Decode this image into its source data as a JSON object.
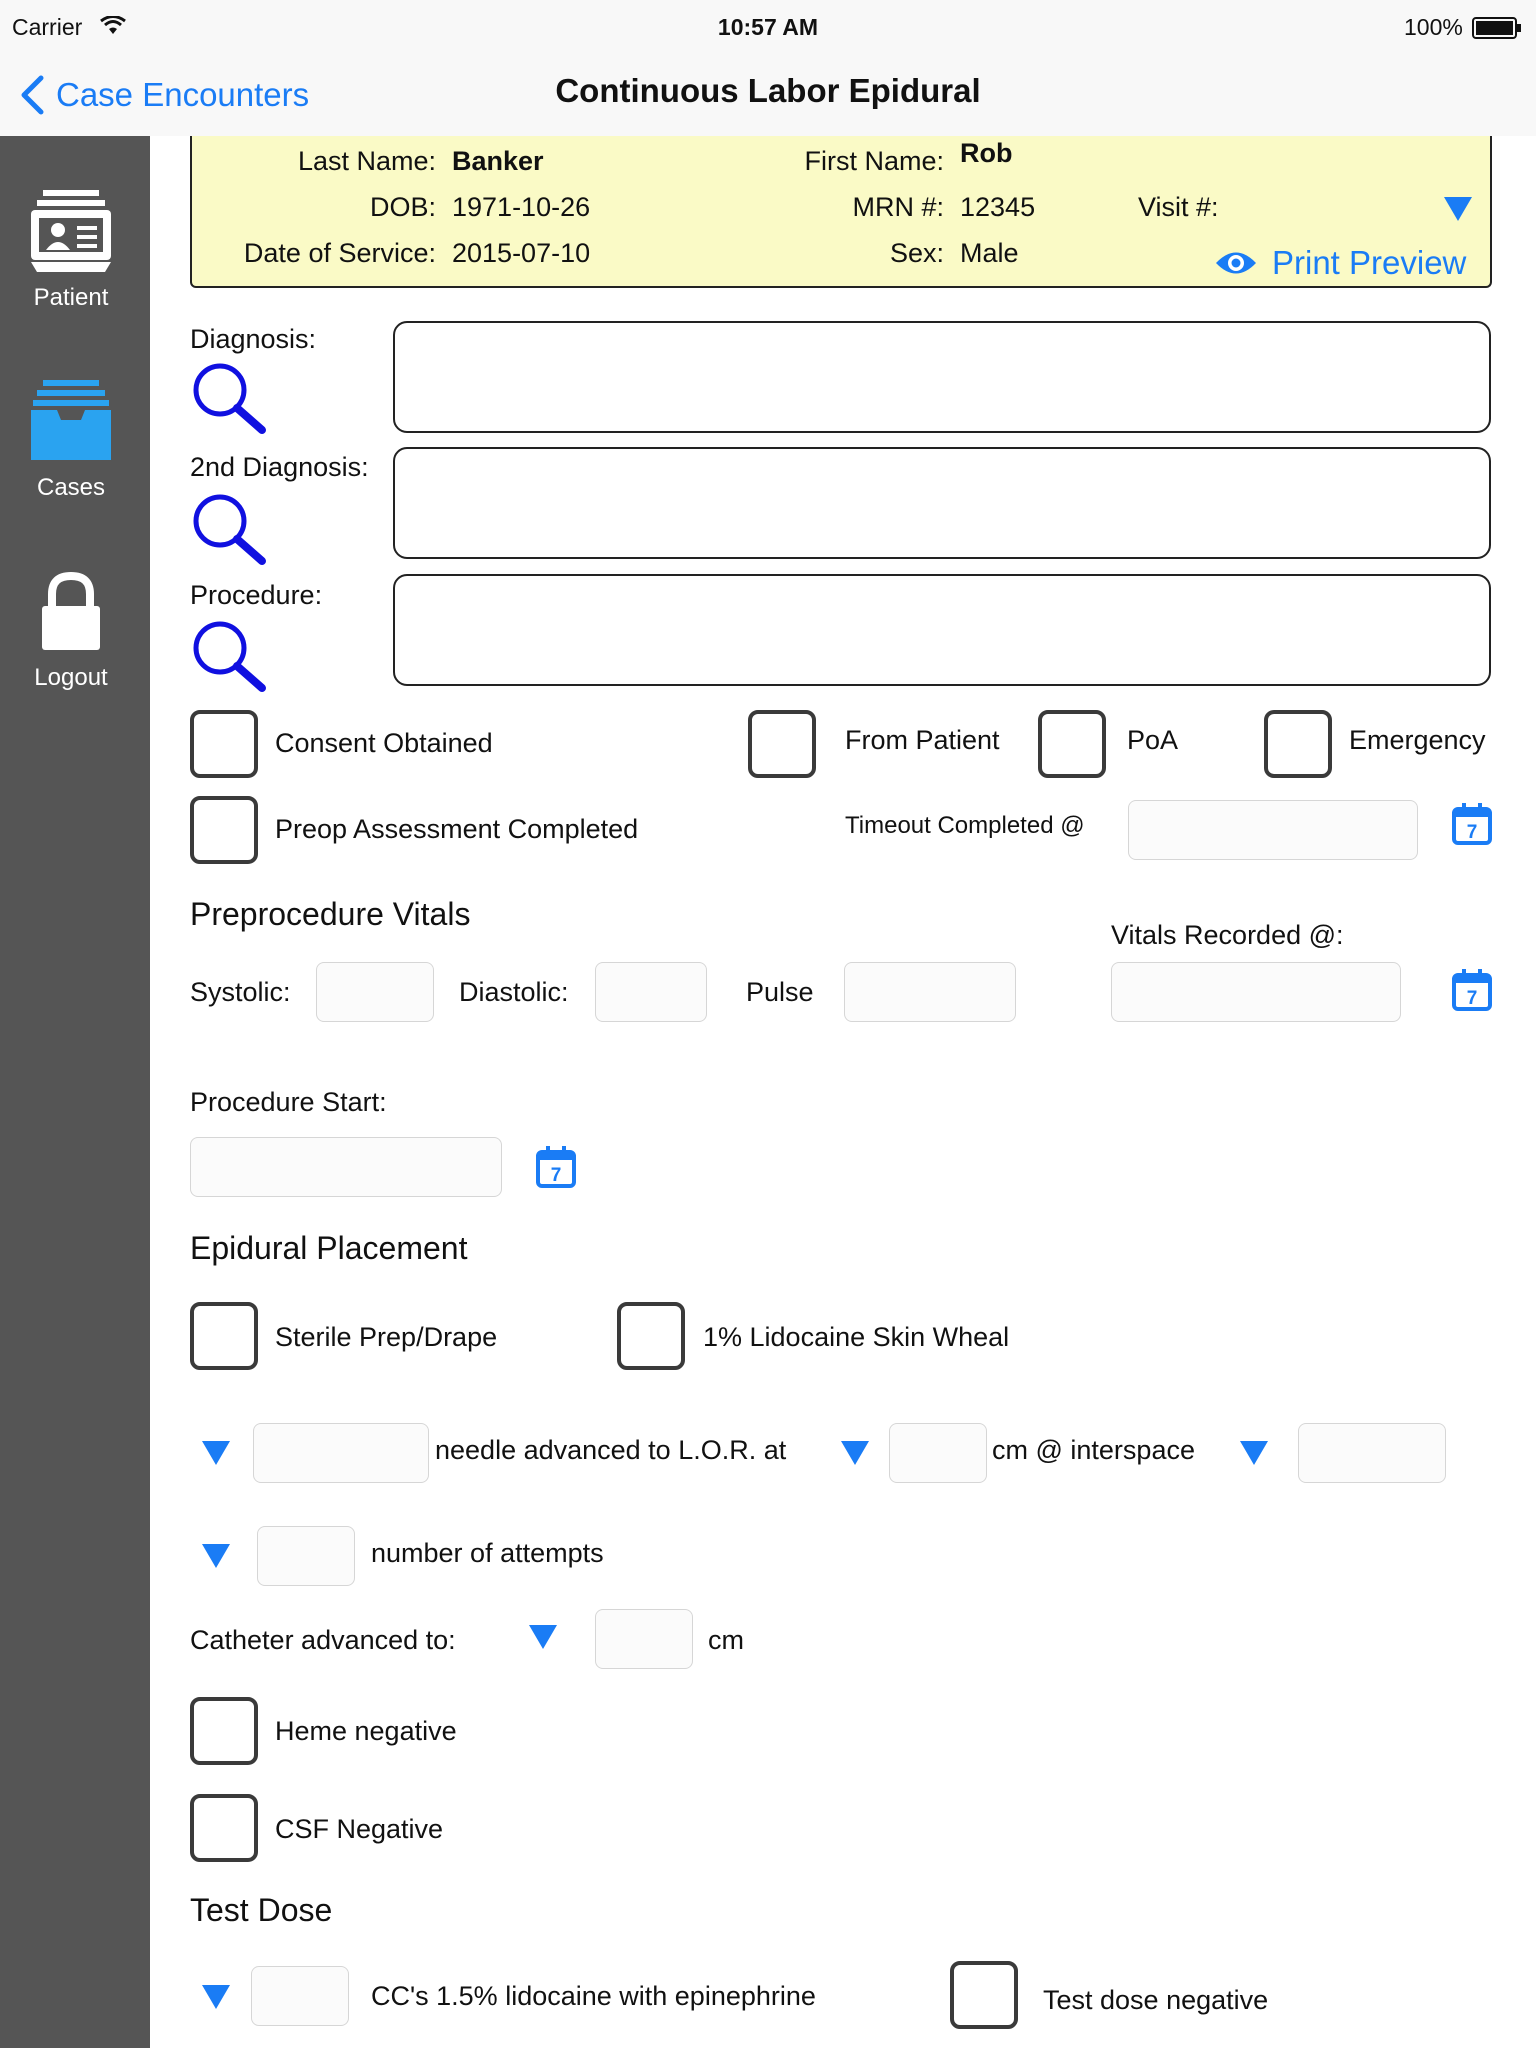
{
  "status_bar": {
    "carrier": "Carrier",
    "time": "10:57 AM",
    "battery": "100%"
  },
  "nav": {
    "back_label": "Case Encounters",
    "title": "Continuous Labor Epidural"
  },
  "sidebar": {
    "items": [
      {
        "label": "Patient",
        "icon": "patient-card-icon"
      },
      {
        "label": "Cases",
        "icon": "cases-tray-icon",
        "active_color": "#2aa3f0"
      },
      {
        "label": "Logout",
        "icon": "lock-icon"
      }
    ]
  },
  "patient_header": {
    "last_name_label": "Last Name:",
    "last_name": "Banker",
    "first_name_label": "First Name:",
    "first_name": "Rob",
    "dob_label": "DOB:",
    "dob": "1971-10-26",
    "mrn_label": "MRN #:",
    "mrn": "12345",
    "visit_label": "Visit #:",
    "visit": "",
    "dos_label": "Date of Service:",
    "dos": "2015-07-10",
    "sex_label": "Sex:",
    "sex": "Male",
    "print_preview": "Print Preview"
  },
  "form": {
    "diagnosis_label": "Diagnosis:",
    "diagnosis2_label": "2nd Diagnosis:",
    "procedure_label": "Procedure:",
    "consent_obtained": "Consent Obtained",
    "from_patient": "From Patient",
    "poa": "PoA",
    "emergency": "Emergency",
    "preop_assessment": "Preop Assessment Completed",
    "timeout_completed": "Timeout Completed @",
    "preprocedure_vitals": "Preprocedure Vitals",
    "vitals_recorded": "Vitals Recorded @:",
    "systolic": "Systolic:",
    "diastolic": "Diastolic:",
    "pulse": "Pulse",
    "procedure_start": "Procedure Start:",
    "epidural_placement": "Epidural Placement",
    "sterile_prep": "Sterile Prep/Drape",
    "lidocaine_wheal": "1% Lidocaine Skin Wheal",
    "needle_advanced": "needle advanced to L.O.R. at",
    "cm_interspace": "cm @ interspace",
    "number_of_attempts": "number of attempts",
    "catheter_advanced": "Catheter advanced to:",
    "cm": "cm",
    "heme_negative": "Heme negative",
    "csf_negative": "CSF Negative",
    "test_dose": "Test Dose",
    "lidocaine_epi": "CC's 1.5% lidocaine with epinephrine",
    "test_dose_negative": "Test dose negative",
    "calendar_day": "7"
  },
  "colors": {
    "accent": "#1a7cf5",
    "sidebar": "#555555",
    "header_bg": "#fafac6",
    "search_icon": "#1010e0"
  }
}
